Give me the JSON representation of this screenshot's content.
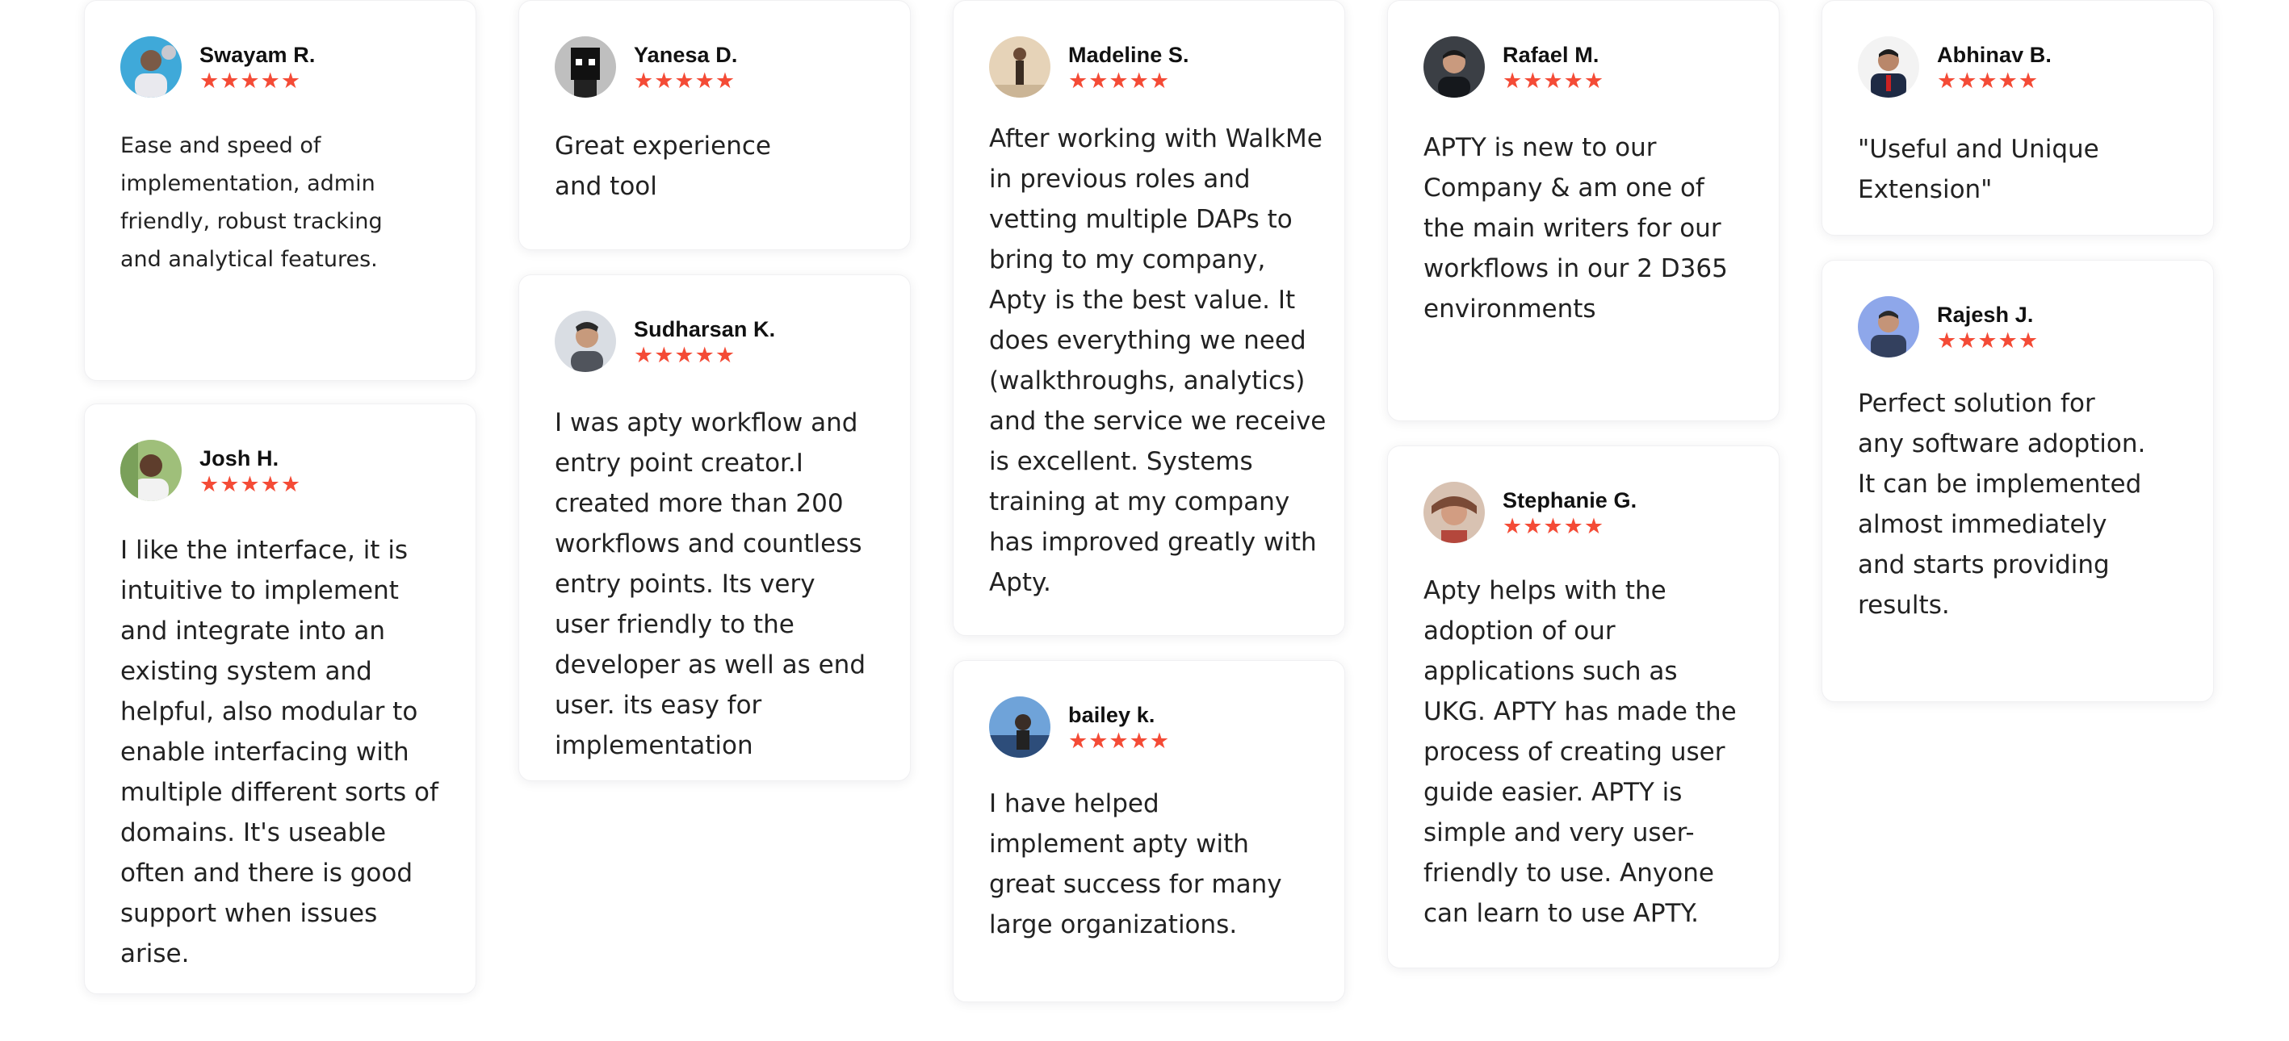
{
  "reviews": [
    {
      "name": "Swayam R.",
      "stars": "★★★★★",
      "text": "Ease and speed of implementation, admin friendly, robust tracking and analytical features."
    },
    {
      "name": "Josh H.",
      "stars": "★★★★★",
      "text": "I like the interface, it is intuitive to implement and integrate into an existing system and helpful, also modular to enable interfacing with multiple different sorts of domains. It's useable often and there is good support when issues arise."
    },
    {
      "name": "Yanesa D.",
      "stars": "★★★★★",
      "text": "Great experience and tool"
    },
    {
      "name": "Sudharsan K.",
      "stars": "★★★★★",
      "text": "I was apty workflow and entry point creator.I created more than 200 workflows and countless entry points. Its very user friendly to the developer as well as end user. its easy for implementation"
    },
    {
      "name": "Madeline S.",
      "stars": "★★★★★",
      "text": "After working with WalkMe in previous roles and vetting multiple DAPs to bring to my company, Apty is the best value. It does everything we need (walkthroughs, analytics) and the service we receive is excellent. Systems training at my company has improved greatly with Apty."
    },
    {
      "name": "bailey k.",
      "stars": "★★★★★",
      "text": "I have helped implement apty with great success for many large organizations."
    },
    {
      "name": "Rafael M.",
      "stars": "★★★★★",
      "text": "APTY is new to our Company & am one of the main writers for our workflows in our 2 D365 environments"
    },
    {
      "name": "Stephanie G.",
      "stars": "★★★★★",
      "text": "Apty helps with the adoption of our applications such as UKG. APTY has made the process of creating user guide easier. APTY is simple and very user-friendly to use. Anyone can learn to use APTY."
    },
    {
      "name": "Abhinav B.",
      "stars": "★★★★★",
      "text": "\"Useful and Unique Extension\""
    },
    {
      "name": "Rajesh J.",
      "stars": "★★★★★",
      "text": "Perfect solution for any software adoption. It can be implemented almost immediately and starts providing results."
    }
  ],
  "colors": {
    "star": "#f44b36",
    "card_border": "#f0f0f2"
  }
}
